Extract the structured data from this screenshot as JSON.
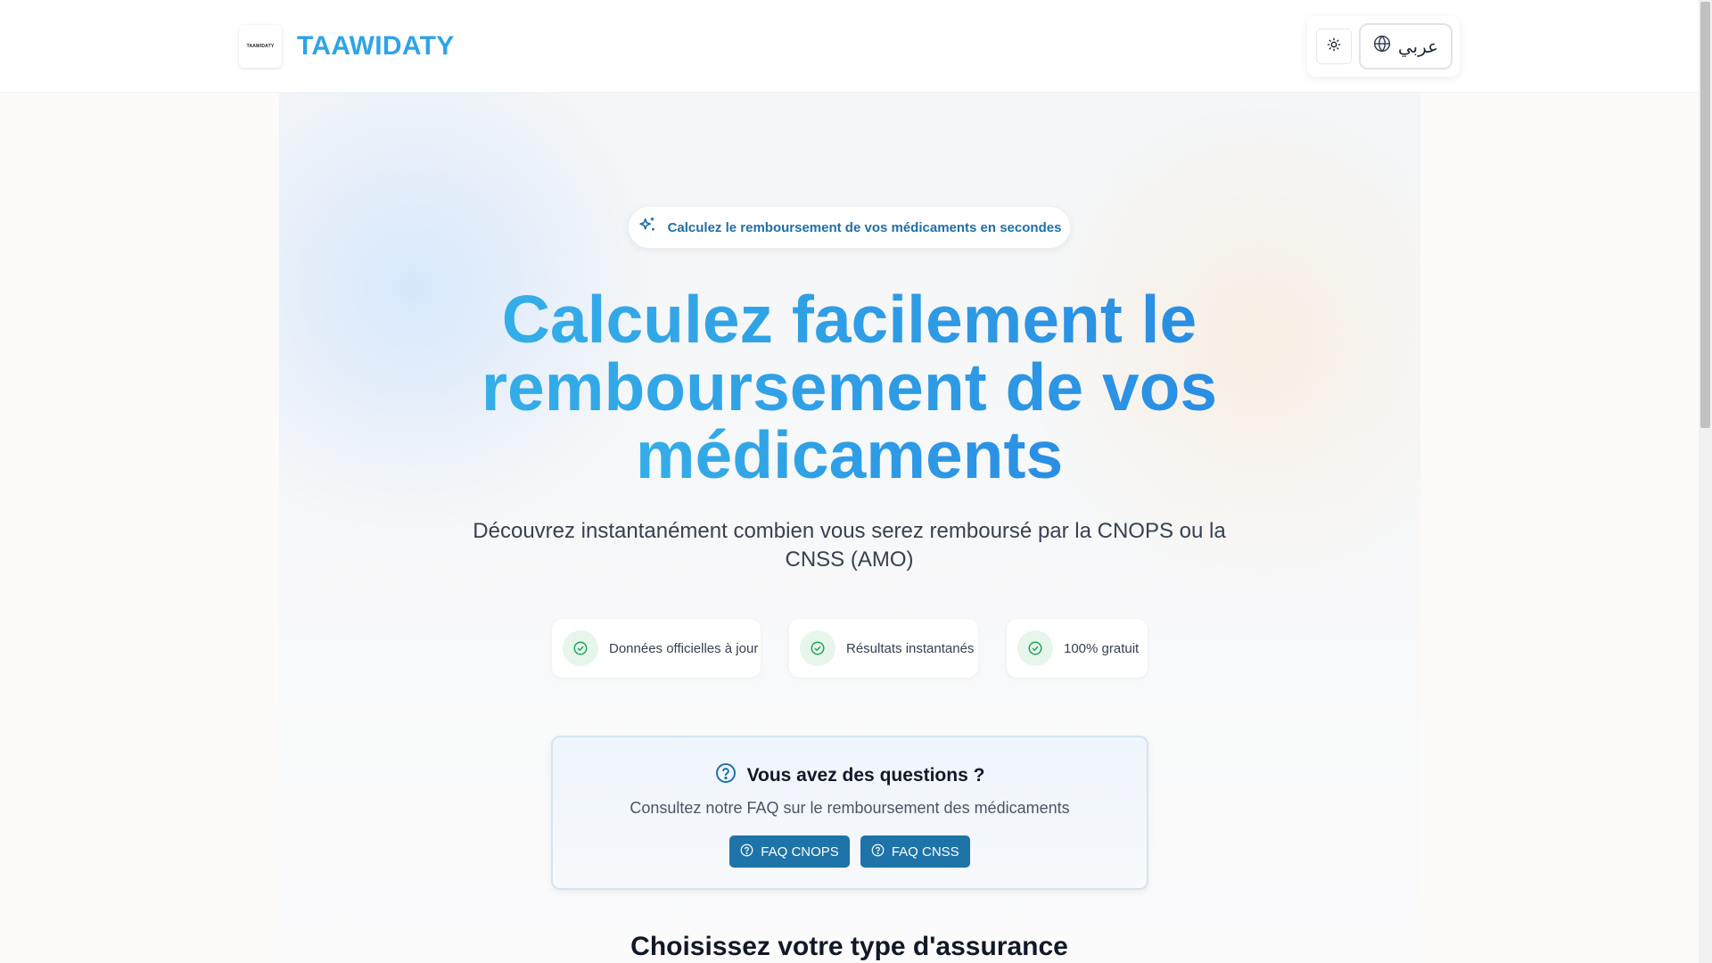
{
  "header": {
    "logo_text": "TAAWIDATY",
    "brand_name": "TAAWIDATY",
    "theme_icon": "sun-icon",
    "lang_icon": "globe-icon",
    "lang_label": "عربي"
  },
  "hero": {
    "badge_icon": "sparkles-icon",
    "badge_text": "Calculez le remboursement de vos médicaments en secondes",
    "title_line1": "Calculez facilement le",
    "title_line2": "remboursement de vos",
    "title_line3": "médicaments",
    "subtitle": "Découvrez instantanément combien vous serez remboursé par la CNOPS ou la CNSS (AMO)",
    "features": [
      {
        "icon": "check-circle-icon",
        "label": "Données officielles à jour"
      },
      {
        "icon": "check-circle-icon",
        "label": "Résultats instantanés"
      },
      {
        "icon": "check-circle-icon",
        "label": "100% gratuit"
      }
    ]
  },
  "faq": {
    "icon": "help-circle-icon",
    "title": "Vous avez des questions ?",
    "subtitle": "Consultez notre FAQ sur le remboursement des médicaments",
    "buttons": [
      {
        "icon": "help-circle-icon",
        "label": "FAQ CNOPS"
      },
      {
        "icon": "help-circle-icon",
        "label": "FAQ CNSS"
      }
    ]
  },
  "section": {
    "title": "Choisissez votre type d'assurance"
  },
  "colors": {
    "brand": "#2ea4e8",
    "primary_button": "#1e73a8",
    "check_green": "#22a35a"
  }
}
